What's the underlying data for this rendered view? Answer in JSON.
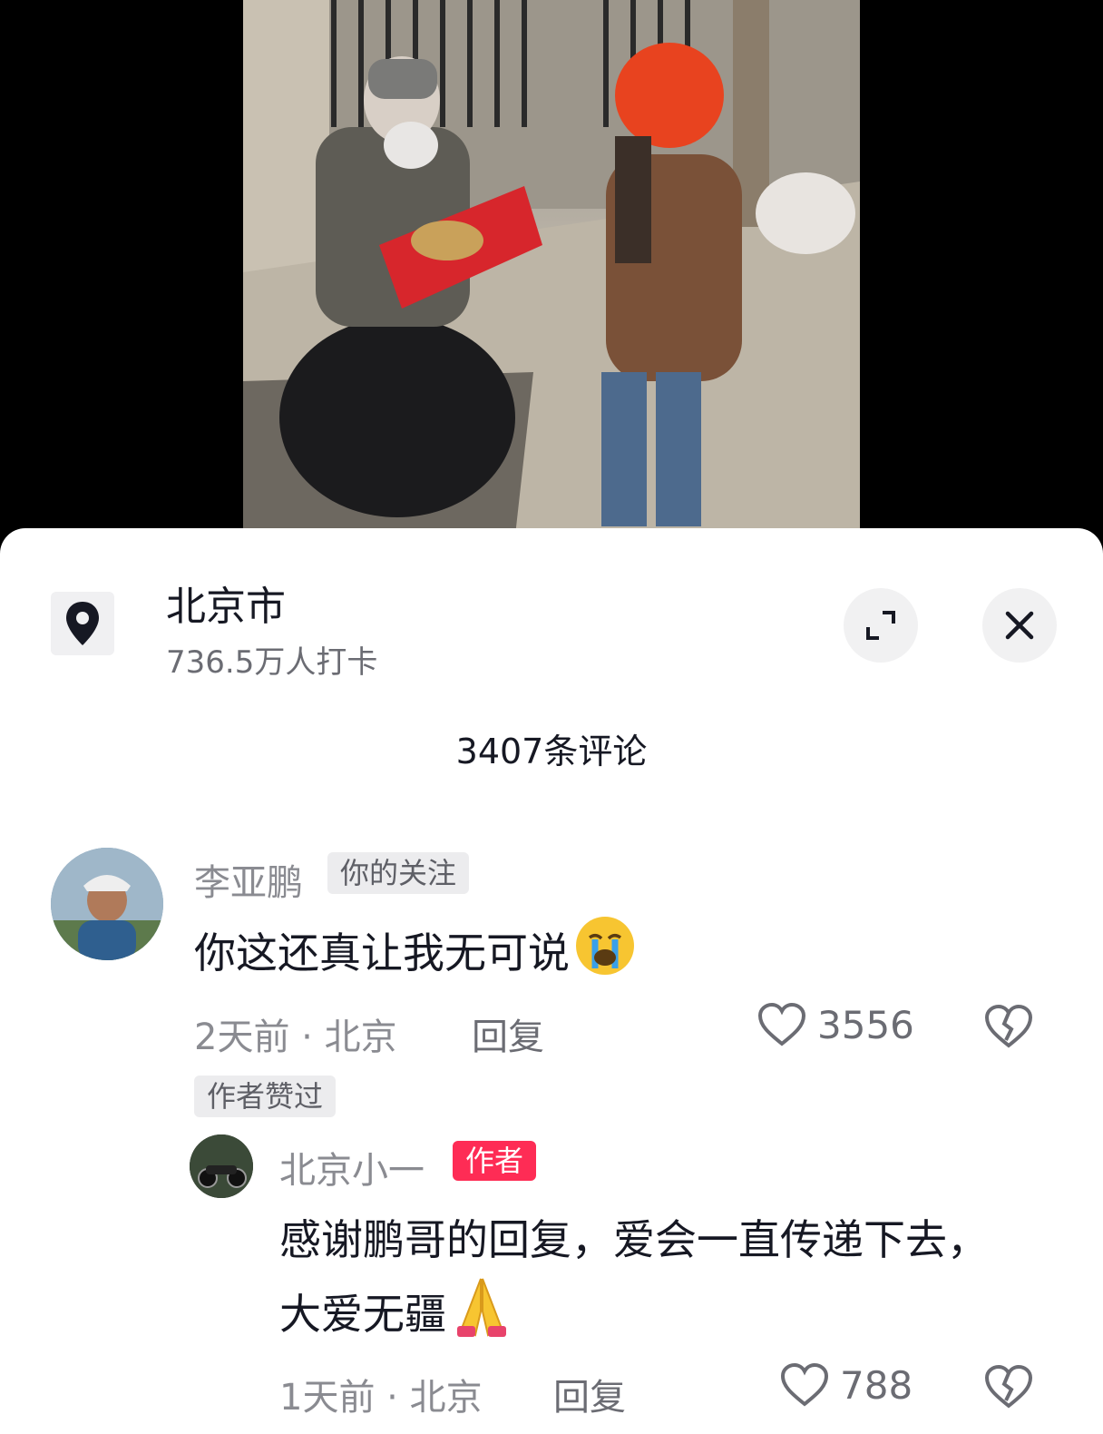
{
  "location": {
    "title": "北京市",
    "subtitle": "736.5万人打卡"
  },
  "comments_count": "3407条评论",
  "comments": [
    {
      "author": "李亚鹏",
      "tag": "你的关注",
      "text": "你这还真让我无可说",
      "emoji": "crying-face",
      "time": "2天前 · 北京",
      "reply_label": "回复",
      "likes": "3556",
      "badge": "作者赞过"
    }
  ],
  "reply": {
    "author": "北京小一",
    "tag": "作者",
    "line1": "感谢鹏哥的回复，爱会一直传递下去，",
    "line2": "大爱无疆",
    "emoji": "folded-hands",
    "time": "1天前 · 北京",
    "reply_label": "回复",
    "likes": "788"
  },
  "colors": {
    "accent": "#fe2c55",
    "text": "#161823",
    "muted": "#8a8b91",
    "helmet": "#e8431f",
    "giftbox": "#d7262c"
  }
}
